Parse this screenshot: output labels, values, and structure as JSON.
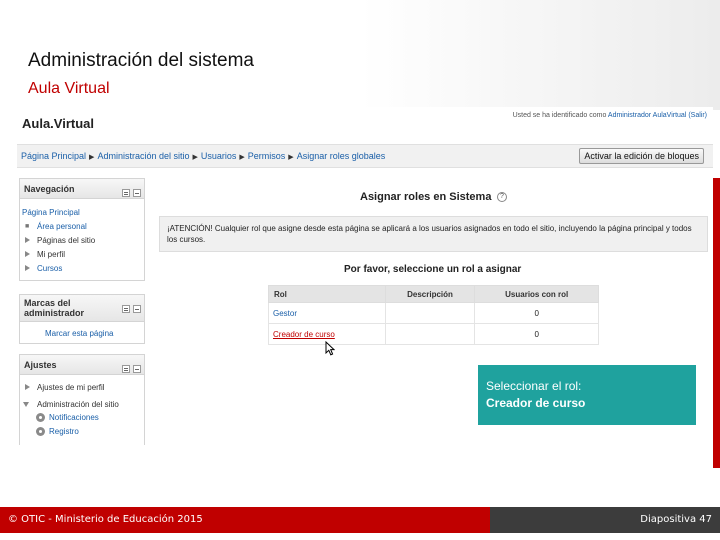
{
  "slide": {
    "title": "Administración del sistema",
    "subtitle": "Aula Virtual"
  },
  "site": {
    "logo": "Aula.Virtual",
    "login_prefix": "Usted se ha identificado como ",
    "login_user": "Administrador AulaVirtual",
    "login_logout": "(Salir)"
  },
  "breadcrumb": {
    "items": [
      "Página Principal",
      "Administración del sitio",
      "Usuarios",
      "Permisos",
      "Asignar roles globales"
    ]
  },
  "edit_button": "Activar la edición de bloques",
  "blocks": {
    "navigation": {
      "title": "Navegación",
      "home": "Página Principal",
      "items": [
        "Área personal",
        "Páginas del sitio",
        "Mi perfil",
        "Cursos"
      ]
    },
    "bookmarks": {
      "title": "Marcas del administrador",
      "link": "Marcar esta página"
    },
    "settings": {
      "title": "Ajustes",
      "profile": "Ajustes de mi perfil",
      "admin": "Administración del sitio",
      "sub_items": [
        "Notificaciones",
        "Registro"
      ]
    }
  },
  "main": {
    "heading": "Asignar roles en Sistema",
    "help_glyph": "?",
    "warning": "¡ATENCIÓN! Cualquier rol que asigne desde esta página se aplicará a los usuarios asignados en todo el sitio, incluyendo la página principal y todos los cursos.",
    "select_heading": "Por favor, seleccione un rol a asignar",
    "table": {
      "headers": [
        "Rol",
        "Descripción",
        "Usuarios con rol"
      ],
      "rows": [
        {
          "role": "Gestor",
          "description": "",
          "count": "0"
        },
        {
          "role": "Creador de curso",
          "description": "",
          "count": "0"
        }
      ]
    }
  },
  "callout": {
    "line1": "Seleccionar el rol:",
    "line2": "Creador de curso"
  },
  "footer": {
    "copyright": "© OTIC - Ministerio de Educación 2015",
    "slide_number": "Diapositiva 47"
  },
  "colors": {
    "accent_red": "#c00000",
    "link_blue": "#1a5fa8",
    "callout_teal": "#1fa29e",
    "footer_dark": "#3c3c3c"
  },
  "icons": [
    "help-icon",
    "dock-icon",
    "hide-icon",
    "gear-icon",
    "mouse-cursor-icon"
  ]
}
